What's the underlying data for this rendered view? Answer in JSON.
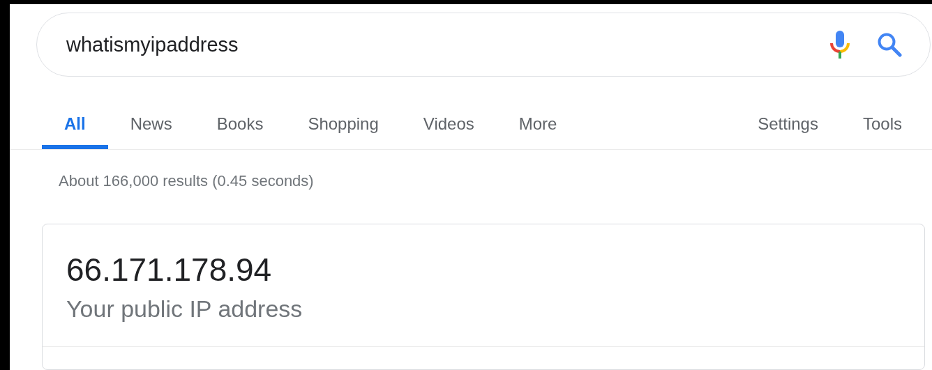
{
  "search": {
    "value": "whatismyipaddress"
  },
  "tabs": [
    {
      "label": "All",
      "selected": true
    },
    {
      "label": "News",
      "selected": false
    },
    {
      "label": "Books",
      "selected": false
    },
    {
      "label": "Shopping",
      "selected": false
    },
    {
      "label": "Videos",
      "selected": false
    },
    {
      "label": "More",
      "selected": false
    }
  ],
  "tools": [
    "Settings",
    "Tools"
  ],
  "result_stats": "About 166,000 results (0.45 seconds)",
  "answer": {
    "ip": "66.171.178.94",
    "caption": "Your public IP address"
  }
}
